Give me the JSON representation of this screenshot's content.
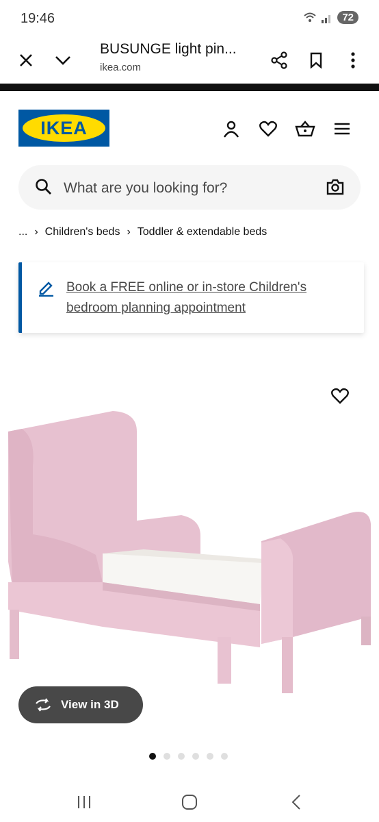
{
  "status": {
    "time": "19:46",
    "battery": "72"
  },
  "browser": {
    "title": "BUSUNGE light pin...",
    "url": "ikea.com"
  },
  "logo": {
    "text": "IKEA"
  },
  "search": {
    "placeholder": "What are you looking for?"
  },
  "breadcrumb": {
    "ellipsis": "...",
    "items": [
      "Children's beds",
      "Toddler & extendable beds"
    ]
  },
  "promo": {
    "text": "Book a FREE online or in-store Children's bedroom planning appointment"
  },
  "view3d": {
    "label": "View in 3D"
  },
  "carousel": {
    "count": 6,
    "active": 0
  },
  "colors": {
    "brand_blue": "#0058a3",
    "brand_yellow": "#ffdb00",
    "product_pink": "#e9c8d5"
  },
  "icons": [
    "close-icon",
    "chevron-down-icon",
    "share-icon",
    "bookmark-icon",
    "more-icon",
    "profile-icon",
    "heart-icon",
    "basket-icon",
    "menu-icon",
    "search-icon",
    "camera-icon",
    "edit-icon",
    "rotate-icon"
  ]
}
